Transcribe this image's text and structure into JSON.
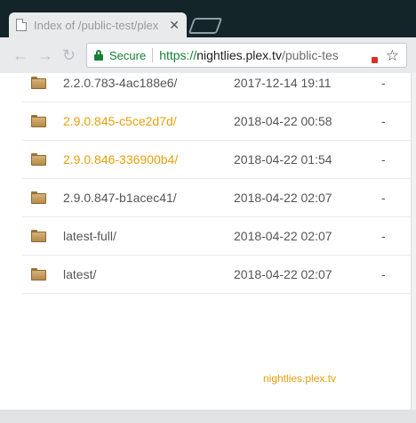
{
  "tab": {
    "title": "Index of /public-test/plex",
    "close_glyph": "✕"
  },
  "toolbar": {
    "back_glyph": "←",
    "forward_glyph": "→",
    "reload_glyph": "↻",
    "secure_label": "Secure",
    "url_scheme": "https://",
    "url_host": "nightlies.plex.tv",
    "url_path": "/public-tes",
    "star_glyph": "☆"
  },
  "listing": {
    "rows": [
      {
        "name": "2.2.0.783-4ac188e6/",
        "date": "2017-12-14 19:11",
        "size": "-",
        "highlighted": false
      },
      {
        "name": "2.9.0.845-c5ce2d7d/",
        "date": "2018-04-22 00:58",
        "size": "-",
        "highlighted": true
      },
      {
        "name": "2.9.0.846-336900b4/",
        "date": "2018-04-22 01:54",
        "size": "-",
        "highlighted": true
      },
      {
        "name": "2.9.0.847-b1acec41/",
        "date": "2018-04-22 02:07",
        "size": "-",
        "highlighted": false
      },
      {
        "name": "latest-full/",
        "date": "2018-04-22 02:07",
        "size": "-",
        "highlighted": false
      },
      {
        "name": "latest/",
        "date": "2018-04-22 02:07",
        "size": "-",
        "highlighted": false
      }
    ]
  },
  "footer": {
    "text": "nightlies.plex.tv"
  },
  "colors": {
    "accent": "#e5a00d",
    "secure_green": "#188038",
    "text": "#555555"
  }
}
